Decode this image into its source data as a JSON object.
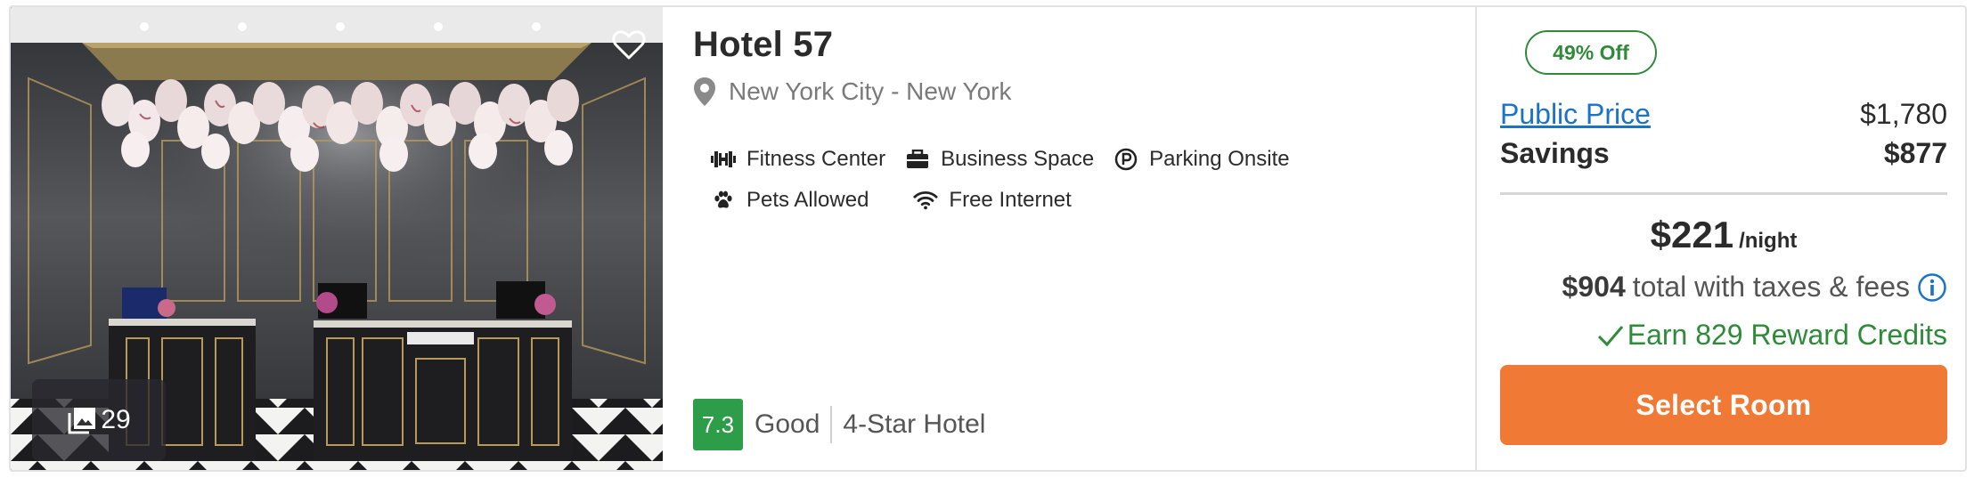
{
  "hotel": {
    "name": "Hotel 57",
    "location": "New York City - New York",
    "photo_count": "29"
  },
  "amenities": {
    "row1": [
      {
        "label": "Fitness Center",
        "icon": "dumbbell-icon"
      },
      {
        "label": "Business Space",
        "icon": "briefcase-icon"
      },
      {
        "label": "Parking Onsite",
        "icon": "parking-icon"
      }
    ],
    "row2": [
      {
        "label": "Pets Allowed",
        "icon": "paw-icon"
      },
      {
        "label": "Free Internet",
        "icon": "wifi-icon"
      }
    ]
  },
  "rating": {
    "score": "7.3",
    "word": "Good",
    "star_class": "4-Star Hotel",
    "score_color": "#2e9d4a"
  },
  "pricing": {
    "discount_badge": "49% Off",
    "public_price_label": "Public Price",
    "public_price_value": "$1,780",
    "savings_label": "Savings",
    "savings_value": "$877",
    "nightly_price": "$221",
    "per_night": "/night",
    "total_amount": "$904",
    "total_text": "total with taxes & fees",
    "reward_text": "Earn 829 Reward Credits",
    "select_button": "Select Room"
  },
  "colors": {
    "accent_orange": "#f07a35",
    "link_blue": "#1a73c8",
    "green": "#2f8a3a"
  }
}
